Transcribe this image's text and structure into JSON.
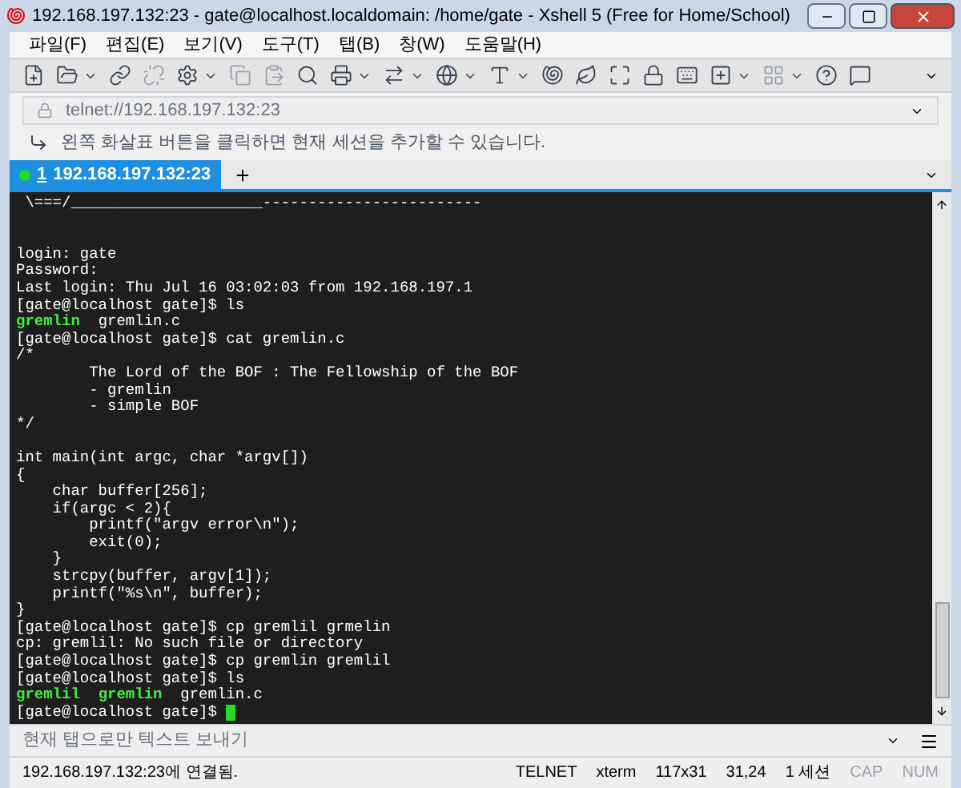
{
  "window": {
    "title": "192.168.197.132:23 - gate@localhost.localdomain: /home/gate - Xshell 5 (Free for Home/School)"
  },
  "menu": [
    "파일(F)",
    "편집(E)",
    "보기(V)",
    "도구(T)",
    "탭(B)",
    "창(W)",
    "도움말(H)"
  ],
  "address_bar": {
    "value": "telnet://192.168.197.132:23"
  },
  "hint": "왼쪽 화살표 버튼을 클릭하면 현재 세션을 추가할 수 있습니다.",
  "tabs": [
    {
      "number": "1",
      "label": "192.168.197.132:23",
      "selected": true,
      "connected": true
    }
  ],
  "terminal": {
    "cursor": true,
    "lines": [
      {
        "segments": [
          {
            "kind": "plain",
            "text": " \\===/_____________________------------------------"
          }
        ]
      },
      {
        "kind": "blank"
      },
      {
        "kind": "blank"
      },
      {
        "segments": [
          {
            "kind": "plain",
            "text": "login: gate"
          }
        ]
      },
      {
        "segments": [
          {
            "kind": "plain",
            "text": "Password:"
          }
        ]
      },
      {
        "segments": [
          {
            "kind": "plain",
            "text": "Last login: Thu Jul 16 03:02:03 from 192.168.197.1"
          }
        ]
      },
      {
        "segments": [
          {
            "kind": "plain",
            "text": "[gate@localhost gate]$ ls"
          }
        ]
      },
      {
        "segments": [
          {
            "kind": "exec",
            "text": "gremlin"
          },
          {
            "kind": "plain",
            "text": "  gremlin.c"
          }
        ]
      },
      {
        "segments": [
          {
            "kind": "plain",
            "text": "[gate@localhost gate]$ cat gremlin.c"
          }
        ]
      },
      {
        "segments": [
          {
            "kind": "plain",
            "text": "/*"
          }
        ]
      },
      {
        "segments": [
          {
            "kind": "plain",
            "text": "        The Lord of the BOF : The Fellowship of the BOF"
          }
        ]
      },
      {
        "segments": [
          {
            "kind": "plain",
            "text": "        - gremlin"
          }
        ]
      },
      {
        "segments": [
          {
            "kind": "plain",
            "text": "        - simple BOF"
          }
        ]
      },
      {
        "segments": [
          {
            "kind": "plain",
            "text": "*/"
          }
        ]
      },
      {
        "kind": "blank"
      },
      {
        "segments": [
          {
            "kind": "plain",
            "text": "int main(int argc, char *argv[])"
          }
        ]
      },
      {
        "segments": [
          {
            "kind": "plain",
            "text": "{"
          }
        ]
      },
      {
        "segments": [
          {
            "kind": "plain",
            "text": "    char buffer[256];"
          }
        ]
      },
      {
        "segments": [
          {
            "kind": "plain",
            "text": "    if(argc < 2){"
          }
        ]
      },
      {
        "segments": [
          {
            "kind": "plain",
            "text": "        printf(\"argv error\\n\");"
          }
        ]
      },
      {
        "segments": [
          {
            "kind": "plain",
            "text": "        exit(0);"
          }
        ]
      },
      {
        "segments": [
          {
            "kind": "plain",
            "text": "    }"
          }
        ]
      },
      {
        "segments": [
          {
            "kind": "plain",
            "text": "    strcpy(buffer, argv[1]);"
          }
        ]
      },
      {
        "segments": [
          {
            "kind": "plain",
            "text": "    printf(\"%s\\n\", buffer);"
          }
        ]
      },
      {
        "segments": [
          {
            "kind": "plain",
            "text": "}"
          }
        ]
      },
      {
        "segments": [
          {
            "kind": "plain",
            "text": "[gate@localhost gate]$ cp gremlil grmelin"
          }
        ]
      },
      {
        "segments": [
          {
            "kind": "plain",
            "text": "cp: gremlil: No such file or directory"
          }
        ]
      },
      {
        "segments": [
          {
            "kind": "plain",
            "text": "[gate@localhost gate]$ cp gremlin gremlil"
          }
        ]
      },
      {
        "segments": [
          {
            "kind": "plain",
            "text": "[gate@localhost gate]$ ls"
          }
        ]
      },
      {
        "segments": [
          {
            "kind": "exec",
            "text": "gremlil"
          },
          {
            "kind": "exec",
            "text": "  gremlin"
          },
          {
            "kind": "plain",
            "text": "  gremlin.c"
          }
        ]
      },
      {
        "segments": [
          {
            "kind": "plain",
            "text": "[gate@localhost gate]$ "
          }
        ]
      }
    ]
  },
  "compose": {
    "placeholder": "현재 탭으로만 텍스트 보내기"
  },
  "status_bar": {
    "connection": "192.168.197.132:23에 연결됨.",
    "items": [
      {
        "text": "TELNET",
        "active": true
      },
      {
        "text": "xterm",
        "active": true
      },
      {
        "text": "117x31",
        "active": true
      },
      {
        "text": "31,24",
        "active": true
      },
      {
        "text": "1 세션",
        "active": true
      },
      {
        "text": "CAP",
        "active": false
      },
      {
        "text": "NUM",
        "active": false
      }
    ]
  }
}
